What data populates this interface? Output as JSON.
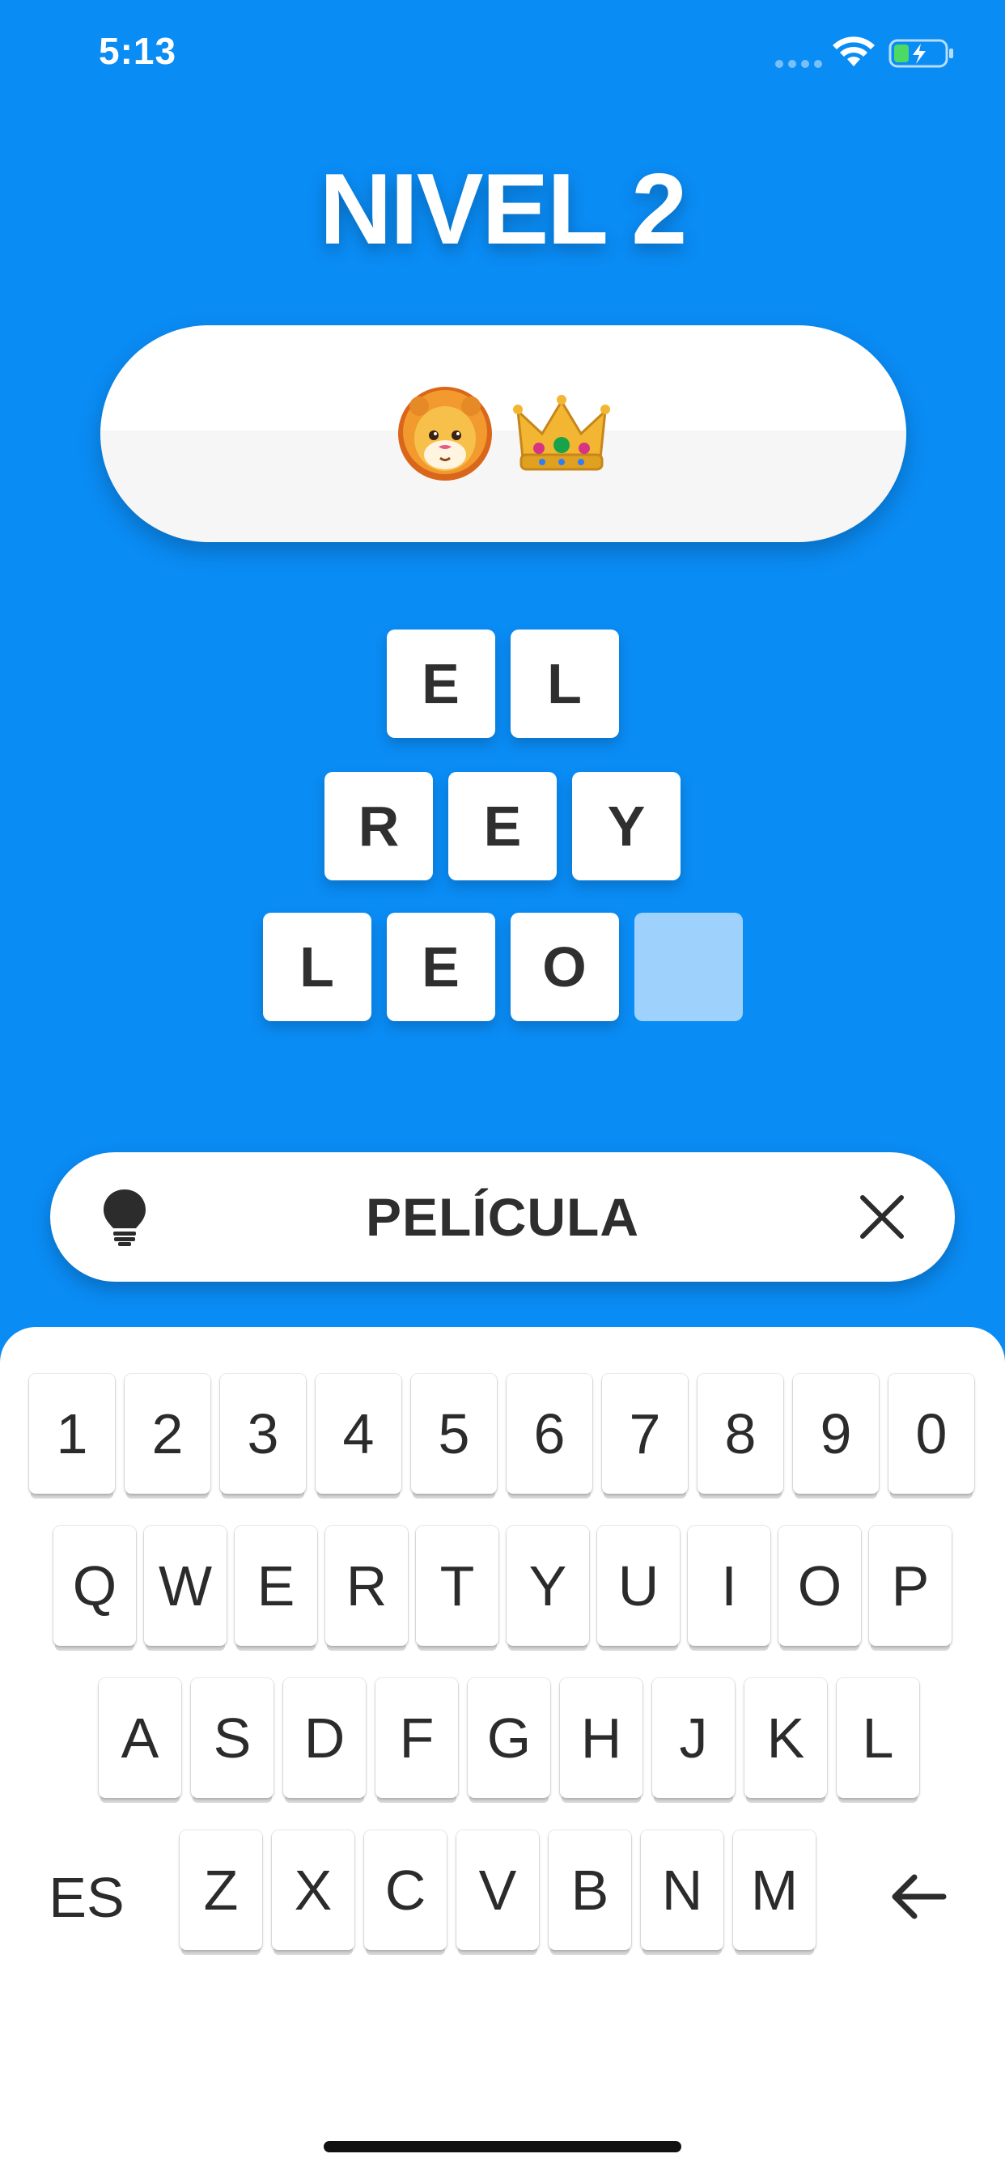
{
  "status_bar": {
    "time": "5:13"
  },
  "level": {
    "title": "NIVEL 2"
  },
  "clue": {
    "emojis": [
      "lion-face",
      "crown"
    ]
  },
  "answer": {
    "rows": [
      [
        "E",
        "L"
      ],
      [
        "R",
        "E",
        "Y"
      ],
      [
        "L",
        "E",
        "O",
        ""
      ]
    ]
  },
  "hint": {
    "category": "PELÍCULA",
    "icon": "lightbulb-icon",
    "close_icon": "close-icon"
  },
  "keyboard": {
    "numbers": [
      "1",
      "2",
      "3",
      "4",
      "5",
      "6",
      "7",
      "8",
      "9",
      "0"
    ],
    "row1": [
      "Q",
      "W",
      "E",
      "R",
      "T",
      "Y",
      "U",
      "I",
      "O",
      "P"
    ],
    "row2": [
      "A",
      "S",
      "D",
      "F",
      "G",
      "H",
      "J",
      "K",
      "L"
    ],
    "row3": [
      "Z",
      "X",
      "C",
      "V",
      "B",
      "N",
      "M"
    ],
    "language": "ES",
    "backspace_icon": "backspace-arrow-icon"
  },
  "colors": {
    "background": "#0A8CF5",
    "empty_tile": "#9ED2FC",
    "text": "#2F2F2F"
  }
}
